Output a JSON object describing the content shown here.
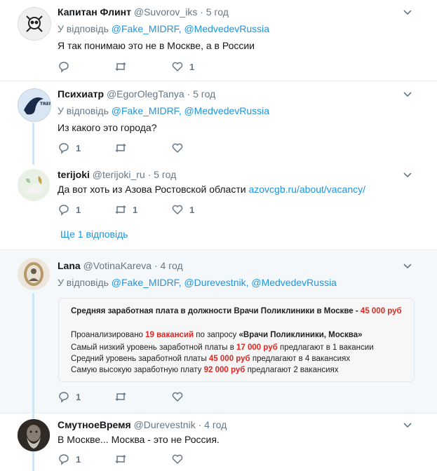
{
  "tweets": [
    {
      "name": "Капитан Флинт",
      "handle": "@Suvorov_iks",
      "time": "· 5 год",
      "reply_prefix": "У відповідь",
      "mentions": "@Fake_MIDRF, @MedvedevRussia",
      "text": "Я так понимаю это не в Москве, а в России",
      "replies": "",
      "retweets": "",
      "likes": "1"
    },
    {
      "name": "Психиатр",
      "handle": "@EgorOlegTanya",
      "time": "· 5 год",
      "reply_prefix": "У відповідь",
      "mentions": "@Fake_MIDRF, @MedvedevRussia",
      "text": "Из какого это города?",
      "replies": "1",
      "retweets": "",
      "likes": ""
    },
    {
      "name": "terijoki",
      "handle": "@terijoki_ru",
      "time": "· 5 год",
      "text_prefix": "Да вот хоть из Азова Ростовской области",
      "text_link": "azovcgb.ru/about/vacancy/",
      "replies": "1",
      "retweets": "1",
      "likes": "1"
    },
    {
      "name": "Lana",
      "handle": "@VotinaKareva",
      "time": "· 4 год",
      "reply_prefix": "У відповідь",
      "mentions": "@Fake_MIDRF, @Durevestnik, @MedvedevRussia",
      "replies": "1",
      "retweets": "",
      "likes": ""
    },
    {
      "name": "СмутноеВремя",
      "handle": "@Durevestnik",
      "time": "· 4 год",
      "text": "В Москве... Москва - это не Россия.",
      "replies": "1",
      "retweets": "",
      "likes": ""
    }
  ],
  "show_replies": "Ще 1 відповідь",
  "card": {
    "title": "Средняя заработная плата в должности Врачи Поликлиники в Москве -",
    "title_value": "45 000 руб",
    "l1_a": "Проанализировано",
    "l1_b": "19 вакансий",
    "l1_c": "по запросу",
    "l1_d": "«Врачи Поликлиники, Москва»",
    "l2_a": "Самый низкий уровень заработной платы в",
    "l2_b": "17 000 руб",
    "l2_c": "предлагают в 1 вакансии",
    "l3_a": "Средний уровень заработной платы",
    "l3_b": "45 000 руб",
    "l3_c": "предлагают в 4 вакансиях",
    "l4_a": "Самую высокую заработную плату",
    "l4_b": "92 000 руб",
    "l4_c": "предлагают 2 вакансиях"
  },
  "colors": {
    "link": "#1b95e0",
    "muted": "#657786",
    "thread": "#cfe4f5",
    "highlight": "#e0261f"
  }
}
